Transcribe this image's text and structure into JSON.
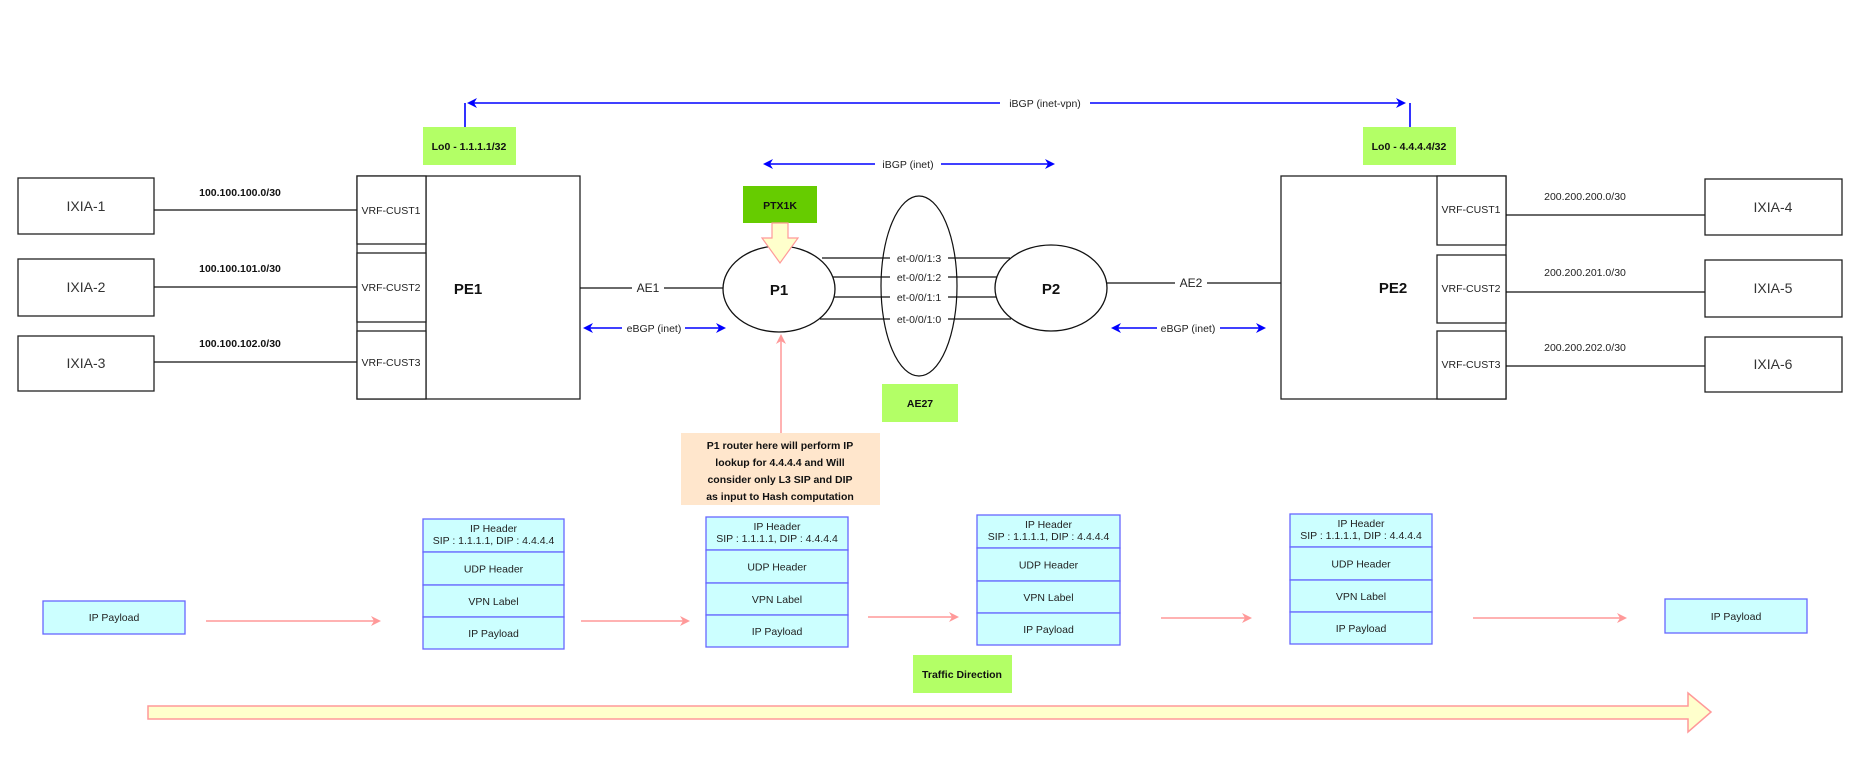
{
  "colors": {
    "link_blue": "#0000ff",
    "packet_fill": "#ccffff",
    "packet_border": "#6666ff",
    "label_green": "#b3ff66",
    "ptx_green": "#66cc00",
    "note_fill": "#ffe6cc",
    "flow_arrow": "#ff9999",
    "direction_arrow_fill": "#ffffcc"
  },
  "sessions": {
    "ibgp_vpn": "iBGP (inet-vpn)",
    "ibgp_inet": "iBGP (inet)",
    "ebgp_left": "eBGP (inet)",
    "ebgp_right": "eBGP (inet)"
  },
  "loopbacks": {
    "pe1": "Lo0 - 1.1.1.1/32",
    "pe2": "Lo0 - 4.4.4.4/32"
  },
  "left_ixias": [
    {
      "name": "IXIA-1",
      "subnet": "100.100.100.0/30",
      "vrf": "VRF-CUST1"
    },
    {
      "name": "IXIA-2",
      "subnet": "100.100.101.0/30",
      "vrf": "VRF-CUST2"
    },
    {
      "name": "IXIA-3",
      "subnet": "100.100.102.0/30",
      "vrf": "VRF-CUST3"
    }
  ],
  "right_ixias": [
    {
      "name": "IXIA-4",
      "subnet": "200.200.200.0/30",
      "vrf": "VRF-CUST1"
    },
    {
      "name": "IXIA-5",
      "subnet": "200.200.201.0/30",
      "vrf": "VRF-CUST2"
    },
    {
      "name": "IXIA-6",
      "subnet": "200.200.202.0/30",
      "vrf": "VRF-CUST3"
    }
  ],
  "routers": {
    "pe1": "PE1",
    "pe2": "PE2",
    "p1": "P1",
    "p2": "P2",
    "ptx": "PTX1K"
  },
  "links": {
    "ae1": "AE1",
    "ae2": "AE2",
    "ae27": "AE27",
    "members": [
      "et-0/0/1:3",
      "et-0/0/1:2",
      "et-0/0/1:1",
      "et-0/0/1:0"
    ]
  },
  "note": [
    "P1 router here will perform IP",
    "lookup for 4.4.4.4 and Will",
    "consider only L3 SIP and DIP",
    "as input to Hash computation"
  ],
  "packet": {
    "header_title": "IP Header",
    "header_addr": "SIP : 1.1.1.1, DIP : 4.4.4.4",
    "udp": "UDP Header",
    "vpn": "VPN Label",
    "payload": "IP Payload"
  },
  "ingress_payload": "IP Payload",
  "egress_payload": "IP Payload",
  "traffic_direction": "Traffic Direction"
}
